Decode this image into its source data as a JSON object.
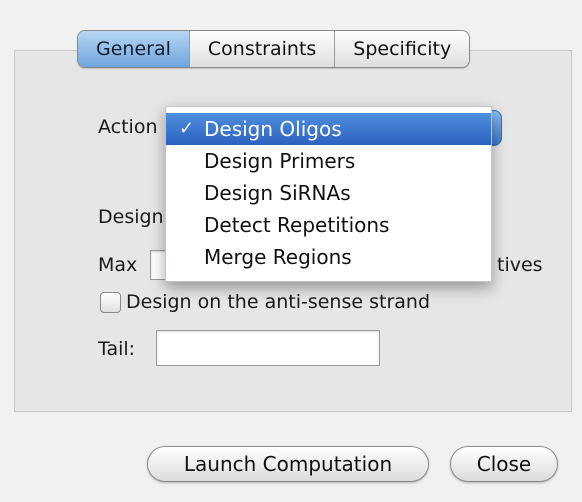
{
  "tabs": [
    "General",
    "Constraints",
    "Specificity"
  ],
  "form": {
    "action_label": "Action",
    "design_label": "Design",
    "max_label": "Max",
    "max_suffix": "tives",
    "antisense_label": "Design on the anti-sense strand",
    "tail_label": "Tail:",
    "tail_value": ""
  },
  "action_menu": {
    "selected": "Design Oligos",
    "items": [
      "Design Oligos",
      "Design Primers",
      "Design SiRNAs",
      "Detect Repetitions",
      "Merge Regions"
    ]
  },
  "buttons": {
    "launch": "Launch Computation",
    "close": "Close"
  },
  "colors": {
    "selection": "#2f66c3",
    "active_tab": "#7aaee2"
  }
}
